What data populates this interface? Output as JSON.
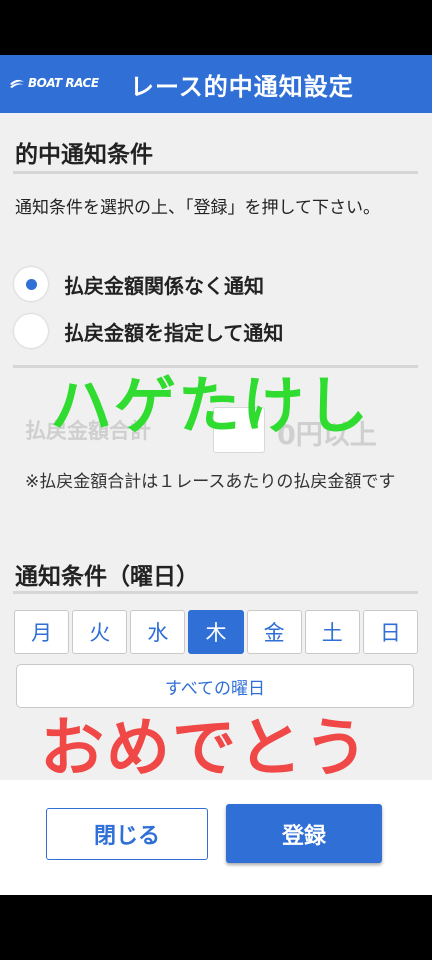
{
  "header": {
    "logo_text": "BOAT RACE",
    "title": "レース的中通知設定"
  },
  "section1": {
    "title": "的中通知条件",
    "description": "通知条件を選択の上、「登録」を押して下さい。",
    "options": [
      {
        "label": "払戻金額関係なく通知",
        "selected": true
      },
      {
        "label": "払戻金額を指定して通知",
        "selected": false
      }
    ]
  },
  "amount": {
    "label": "払戻金額合計",
    "unit": "0円以上",
    "note": "※払戻金額合計は１レースあたりの払戻金額です"
  },
  "section2": {
    "title": "通知条件（曜日）",
    "days": [
      {
        "label": "月",
        "selected": false
      },
      {
        "label": "火",
        "selected": false
      },
      {
        "label": "水",
        "selected": false
      },
      {
        "label": "木",
        "selected": true
      },
      {
        "label": "金",
        "selected": false
      },
      {
        "label": "土",
        "selected": false
      },
      {
        "label": "日",
        "selected": false
      }
    ],
    "all_days_label": "すべての曜日"
  },
  "footer": {
    "close_label": "閉じる",
    "register_label": "登録"
  },
  "overlay": {
    "green_text": "ハゲたけし",
    "red_text": "おめでとう"
  },
  "colors": {
    "accent": "#2f6fd6",
    "overlay_green": "#2fdc2f",
    "overlay_red": "#f04747"
  }
}
